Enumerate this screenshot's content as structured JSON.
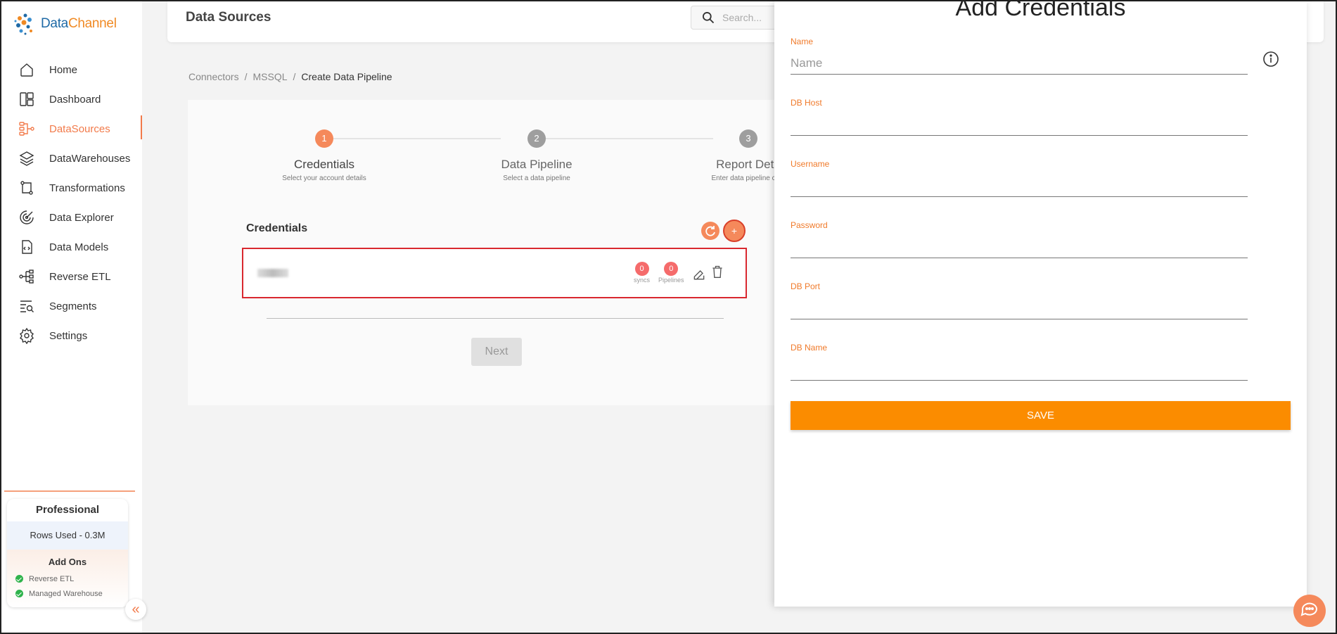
{
  "logo": {
    "brand_a": "Data",
    "brand_b": "Channel"
  },
  "sidebar": {
    "items": [
      {
        "label": "Home",
        "icon": "home-icon"
      },
      {
        "label": "Dashboard",
        "icon": "dashboard-icon"
      },
      {
        "label": "DataSources",
        "icon": "datasources-icon",
        "active": true
      },
      {
        "label": "DataWarehouses",
        "icon": "layers-icon"
      },
      {
        "label": "Transformations",
        "icon": "transformations-icon"
      },
      {
        "label": "Data Explorer",
        "icon": "explorer-icon"
      },
      {
        "label": "Data Models",
        "icon": "models-icon"
      },
      {
        "label": "Reverse ETL",
        "icon": "reverse-etl-icon"
      },
      {
        "label": "Segments",
        "icon": "segments-icon"
      },
      {
        "label": "Settings",
        "icon": "gear-icon"
      }
    ],
    "plan": {
      "title": "Professional",
      "rows_used": "Rows Used - 0.3M",
      "addons_title": "Add Ons",
      "addons": [
        "Reverse ETL",
        "Managed Warehouse"
      ]
    },
    "collapse_glyph": "«"
  },
  "header": {
    "title": "Data Sources",
    "search_placeholder": "Search..."
  },
  "breadcrumb": {
    "items": [
      "Connectors",
      "MSSQL"
    ],
    "separator": "/",
    "current": "Create Data Pipeline"
  },
  "stepper": {
    "steps": [
      {
        "number": "1",
        "label": "Credentials",
        "sub": "Select your account details"
      },
      {
        "number": "2",
        "label": "Data Pipeline",
        "sub": "Select a data pipeline"
      },
      {
        "number": "3",
        "label": "Report Deta",
        "sub": "Enter data pipeline conf"
      }
    ]
  },
  "credentials": {
    "title": "Credentials",
    "add_label": "+",
    "row": {
      "syncs_count": "0",
      "syncs_label": "syncs",
      "pipelines_count": "0",
      "pipelines_label": "Pipelines"
    },
    "next_label": "Next"
  },
  "drawer": {
    "title": "Add Credentials",
    "fields": [
      {
        "label": "Name",
        "placeholder": "Name"
      },
      {
        "label": "DB Host",
        "placeholder": ""
      },
      {
        "label": "Username",
        "placeholder": ""
      },
      {
        "label": "Password",
        "placeholder": ""
      },
      {
        "label": "DB Port",
        "placeholder": ""
      },
      {
        "label": "DB Name",
        "placeholder": ""
      }
    ],
    "save_label": "SAVE"
  },
  "colors": {
    "accent": "#f5895b",
    "save": "#fb8c00",
    "label": "#f07a2a",
    "highlight": "#d9282f"
  }
}
